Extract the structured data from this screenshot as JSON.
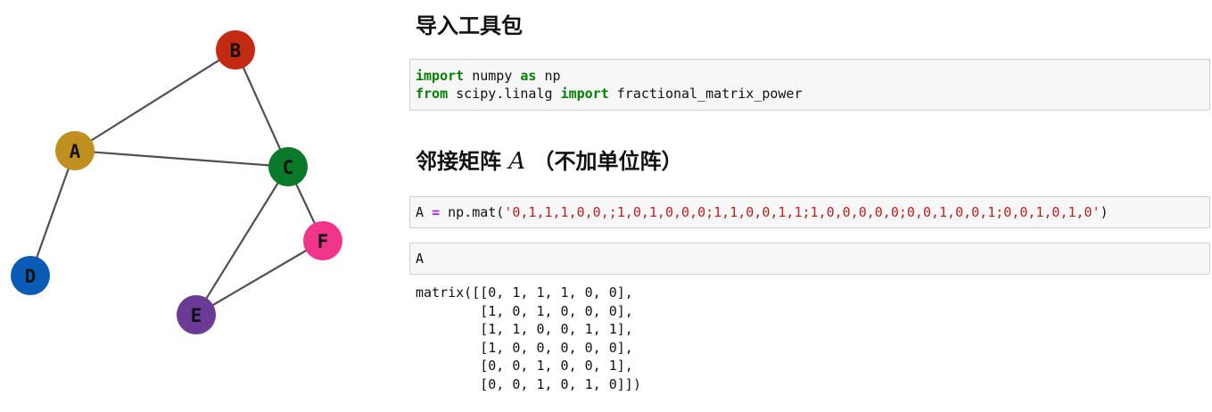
{
  "graph": {
    "nodes": [
      {
        "id": "A",
        "label": "A",
        "color": "#bf8f1f"
      },
      {
        "id": "B",
        "label": "B",
        "color": "#c22a11"
      },
      {
        "id": "C",
        "label": "C",
        "color": "#087a2a"
      },
      {
        "id": "D",
        "label": "D",
        "color": "#0a5bb5"
      },
      {
        "id": "E",
        "label": "E",
        "color": "#6b3a96"
      },
      {
        "id": "F",
        "label": "F",
        "color": "#f0358a"
      }
    ],
    "edges": [
      [
        "A",
        "B"
      ],
      [
        "A",
        "C"
      ],
      [
        "B",
        "C"
      ],
      [
        "A",
        "D"
      ],
      [
        "C",
        "E"
      ],
      [
        "C",
        "F"
      ],
      [
        "E",
        "F"
      ]
    ]
  },
  "sections": {
    "import_heading": "导入工具包",
    "adjacency_heading_prefix": "邻接矩阵",
    "adjacency_heading_math": "A",
    "adjacency_heading_suffix": "（不加单位阵）"
  },
  "cells": {
    "import": {
      "line1": {
        "kw1": "import",
        "t1": " numpy ",
        "kw2": "as",
        "t2": " np"
      },
      "line2": {
        "kw1": "from",
        "t1": " scipy.linalg ",
        "kw2": "import",
        "t2": " fractional_matrix_power"
      }
    },
    "assign": {
      "var": "A ",
      "op": "=",
      "call": " np.mat(",
      "string": "'0,1,1,1,0,0,;1,0,1,0,0,0;1,1,0,0,1,1;1,0,0,0,0,0;0,0,1,0,0,1;0,0,1,0,1,0'",
      "close": ")"
    },
    "display": {
      "code": "A"
    }
  },
  "output": {
    "text": "matrix([[0, 1, 1, 1, 0, 0],\n        [1, 0, 1, 0, 0, 0],\n        [1, 1, 0, 0, 1, 1],\n        [1, 0, 0, 0, 0, 0],\n        [0, 0, 1, 0, 0, 1],\n        [0, 0, 1, 0, 1, 0]])"
  }
}
